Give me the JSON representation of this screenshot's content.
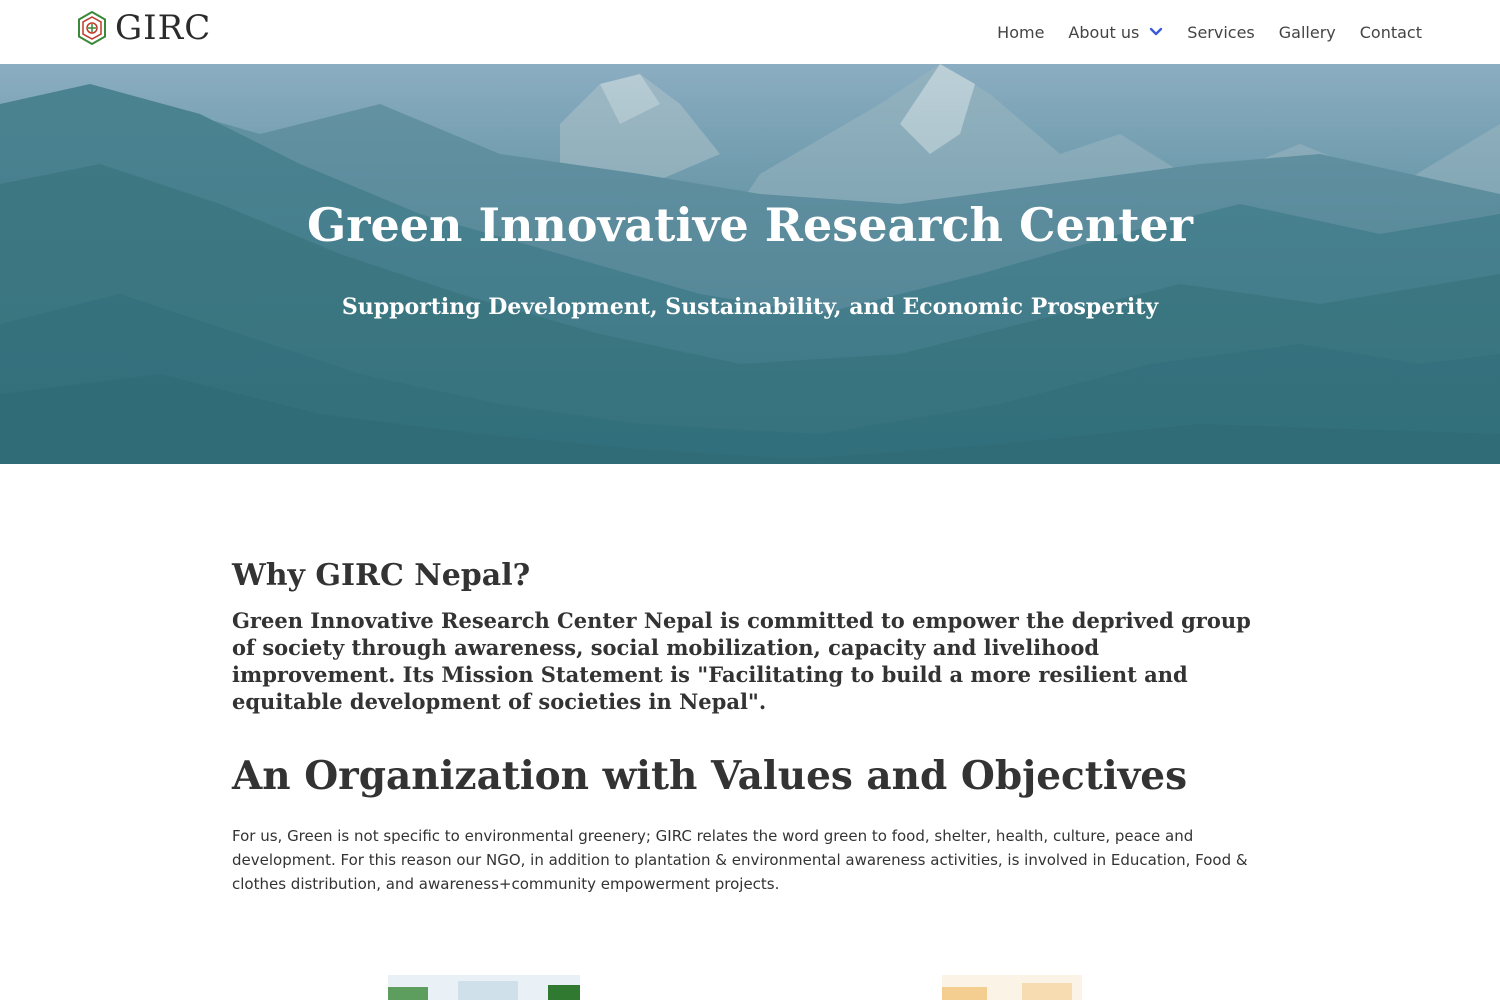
{
  "header": {
    "brand": "GIRC",
    "logo_icon": "girc-logo-icon",
    "nav": [
      {
        "label": "Home"
      },
      {
        "label": "About us",
        "icon": "chevron-down-icon"
      },
      {
        "label": "Services"
      },
      {
        "label": "Gallery"
      },
      {
        "label": "Contact"
      }
    ],
    "accent_color": "#3b5bdb"
  },
  "hero": {
    "title": "Green Innovative Research Center",
    "subtitle": "Supporting Development, Sustainability, and Economic Prosperity",
    "background": "mountain-landscape-image"
  },
  "main": {
    "why_heading": "Why GIRC Nepal?",
    "mission": "Green Innovative Research Center Nepal is committed to empower the deprived group of society through awareness, social mobilization, capacity and livelihood improvement. Its Mission Statement is \"Facilitating to build a more resilient and equitable development of societies in Nepal\".",
    "values_heading": "An Organization with Values and Objectives",
    "values_text": "For us, Green is not specific to environmental greenery; GIRC relates the word green to food, shelter, health, culture, peace and development. For this reason our NGO, in addition to plantation & environmental awareness activities, is involved in Education, Food & clothes distribution, and awareness+community empowerment projects."
  }
}
